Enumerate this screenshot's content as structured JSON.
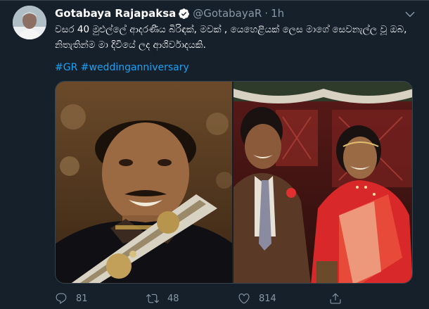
{
  "tweet": {
    "author_name": "Gotabaya Rajapaksa",
    "handle": "@GotabayaR",
    "separator": "·",
    "time": "1h",
    "text_line1": "වසර 40 මුළුල්ලේ ආදරණීය බිරිඳක්, මවක් , යෙහෙළියක් ලෙස මාගේ සෙවනැල්ල වූ ඔබ,",
    "text_line2": "නිතැතින්ම මා දිවියේ ලද ආශිර්වාදයකි.",
    "hashtags": [
      "#GR",
      "#weddinganniversary"
    ]
  },
  "actions": {
    "replies": "81",
    "retweets": "48",
    "likes": "814"
  },
  "colors": {
    "background": "#15202b",
    "text": "#ffffff",
    "muted": "#8899a6",
    "link": "#1da1f2",
    "border": "#38444d"
  },
  "icons": [
    "verified-badge-icon",
    "chevron-down-icon",
    "reply-icon",
    "retweet-icon",
    "like-icon",
    "share-icon"
  ]
}
